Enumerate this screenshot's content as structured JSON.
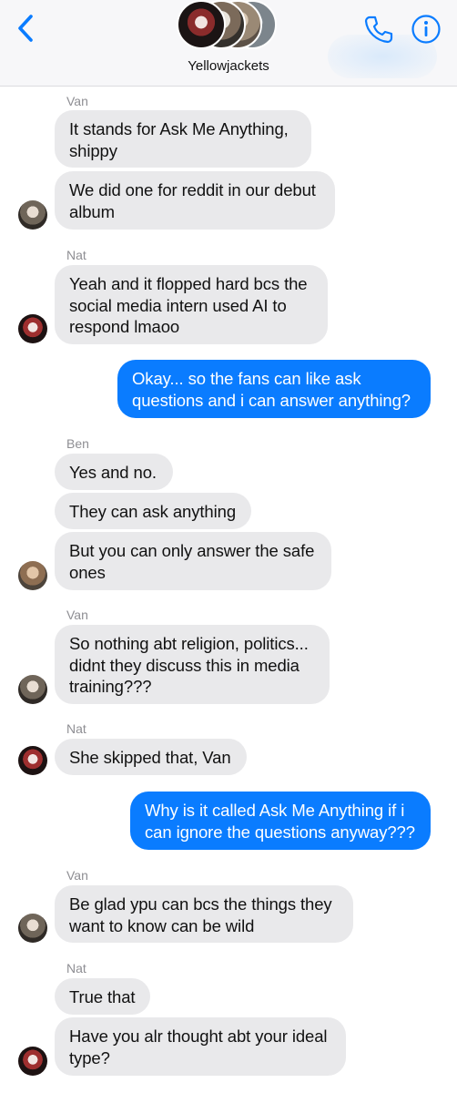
{
  "header": {
    "group_name": "Yellowjackets",
    "back_icon": "chevron-left-icon",
    "call_icon": "phone-icon",
    "info_icon": "info-icon",
    "accent": "#0a7cff"
  },
  "colors": {
    "incoming_bubble": "#e9e9eb",
    "outgoing_bubble": "#0a7cff",
    "sender_label": "#8e8e93"
  },
  "messages": [
    {
      "sender": "Van"
    },
    {
      "line1": "It stands for Ask Me Anything,",
      "line2": "shippy"
    },
    {
      "line1": "We did one for reddit in our debut",
      "line2": "album"
    },
    {
      "sender": "Nat"
    },
    {
      "line1": "Yeah and it flopped hard bcs the",
      "line2": "social media intern used AI to",
      "line3": "respond lmaoo"
    },
    {
      "line1": "Okay... so the fans can like ask",
      "line2": "questions and i can answer anything?"
    },
    {
      "sender": "Ben"
    },
    {
      "line1": "Yes and no."
    },
    {
      "line1": "They can ask anything"
    },
    {
      "line1": "But you can only answer the safe",
      "line2": "ones"
    },
    {
      "sender": "Van"
    },
    {
      "line1": "So nothing abt religion, politics...",
      "line2": "didnt they discuss this in media",
      "line3": "training???"
    },
    {
      "sender": "Nat"
    },
    {
      "line1": "She skipped that, Van"
    },
    {
      "line1": "Why is it called Ask Me Anything if i",
      "line2": "can ignore the questions anyway???"
    },
    {
      "sender": "Van"
    },
    {
      "line1": "Be glad ypu can bcs the things they",
      "line2": "want to know can be wild"
    },
    {
      "sender": "Nat"
    },
    {
      "line1": "True that"
    },
    {
      "line1": "Have you alr thought abt your ideal",
      "line2": "type?"
    }
  ]
}
